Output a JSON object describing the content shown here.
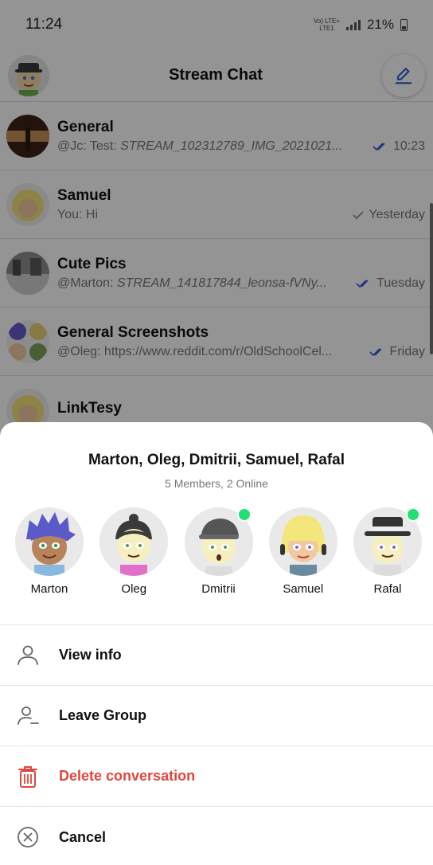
{
  "status_bar": {
    "time": "11:24",
    "network_line1": "Vo) LTE+",
    "network_line2": "LTE1",
    "battery": "21%"
  },
  "header": {
    "title": "Stream Chat"
  },
  "channels": [
    {
      "name": "General",
      "preview_prefix": "@Jc: Test: ",
      "preview_attachment": "STREAM_102312789_IMG_2021021...",
      "time": "10:23",
      "read_state": "double-check-blue"
    },
    {
      "name": "Samuel",
      "preview_prefix": "You: Hi",
      "preview_attachment": "",
      "time": "Yesterday",
      "read_state": "single-check-gray"
    },
    {
      "name": "Cute Pics",
      "preview_prefix": "@Marton: ",
      "preview_attachment": "STREAM_141817844_leonsa-fVNy...",
      "time": "Tuesday",
      "read_state": "double-check-blue"
    },
    {
      "name": "General Screenshots",
      "preview_prefix": "@Oleg: https://www.reddit.com/r/OldSchoolCel...",
      "preview_attachment": "",
      "time": "Friday",
      "read_state": "double-check-blue"
    },
    {
      "name": "LinkTesy",
      "preview_prefix": "",
      "preview_attachment": "",
      "time": "",
      "read_state": ""
    }
  ],
  "sheet": {
    "title": "Marton, Oleg, Dmitrii, Samuel, Rafal",
    "subtitle": "5 Members,  2 Online",
    "members": [
      {
        "name": "Marton",
        "online": false
      },
      {
        "name": "Oleg",
        "online": false
      },
      {
        "name": "Dmitrii",
        "online": true
      },
      {
        "name": "Samuel",
        "online": false
      },
      {
        "name": "Rafal",
        "online": true
      }
    ],
    "actions": {
      "view_info": "View info",
      "leave_group": "Leave Group",
      "delete_conversation": "Delete conversation",
      "cancel": "Cancel"
    }
  },
  "colors": {
    "accent_blue": "#2d5bd6",
    "danger_red": "#e0463c",
    "online_green": "#20e070",
    "overlay": "rgba(0,0,0,0.42)"
  },
  "icons": {
    "compose": "pencil-icon",
    "view_info": "person-icon",
    "leave_group": "person-minus-icon",
    "delete": "trash-icon",
    "cancel": "close-circle-icon"
  }
}
